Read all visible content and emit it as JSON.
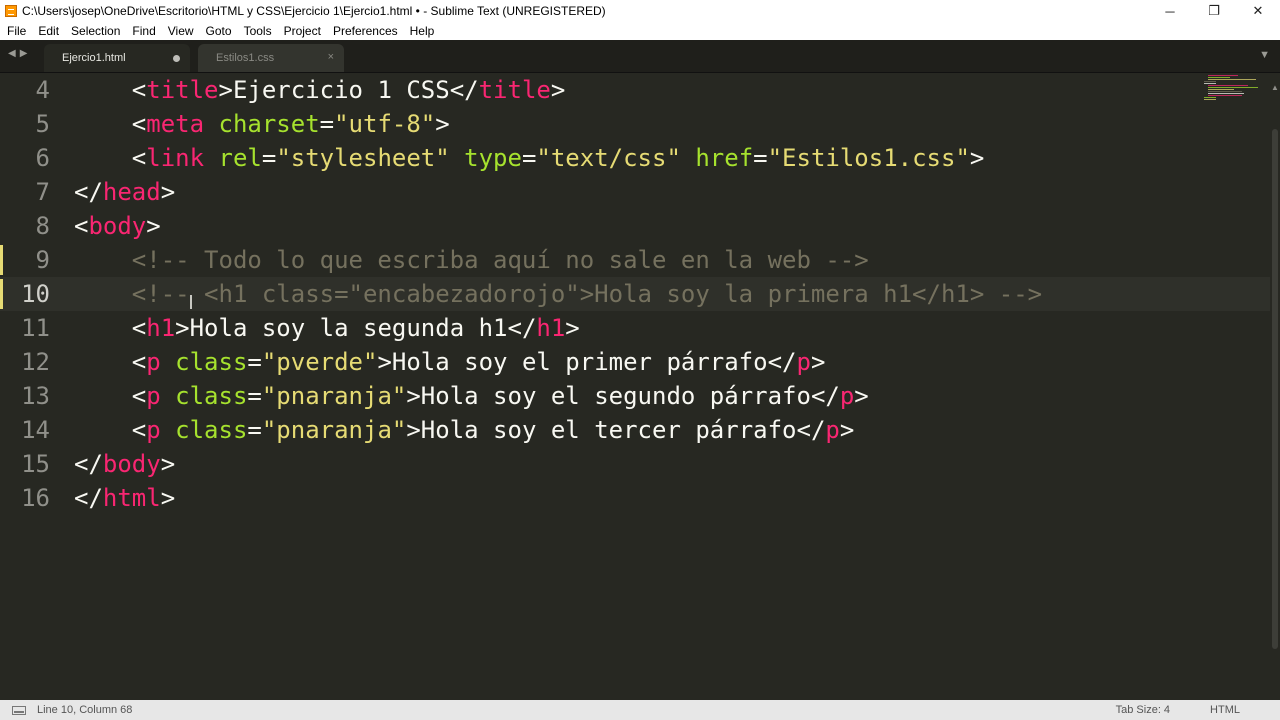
{
  "window": {
    "title": "C:\\Users\\josep\\OneDrive\\Escritorio\\HTML y CSS\\Ejercicio 1\\Ejercio1.html • - Sublime Text (UNREGISTERED)",
    "minimize_glyph": "─",
    "restore_glyph": "❐",
    "close_glyph": "✕"
  },
  "menu": [
    "File",
    "Edit",
    "Selection",
    "Find",
    "View",
    "Goto",
    "Tools",
    "Project",
    "Preferences",
    "Help"
  ],
  "tabs": {
    "active_label": "Ejercio1.html",
    "inactive_label": "Estilos1.css",
    "close_glyph": "×",
    "dropdown_glyph": "▼",
    "nav_left_glyph": "◀",
    "nav_right_glyph": "▶"
  },
  "editor": {
    "current_line": 10,
    "line_numbers": [
      "4",
      "5",
      "6",
      "7",
      "8",
      "9",
      "10",
      "11",
      "12",
      "13",
      "14",
      "15",
      "16"
    ],
    "lines": [
      [
        [
          "pl",
          "    <"
        ],
        [
          "tg",
          "title"
        ],
        [
          "pl",
          ">Ejercicio 1 CSS</"
        ],
        [
          "tg",
          "title"
        ],
        [
          "pl",
          ">"
        ]
      ],
      [
        [
          "pl",
          "    <"
        ],
        [
          "tg",
          "meta"
        ],
        [
          "pl",
          " "
        ],
        [
          "at",
          "charset"
        ],
        [
          "pl",
          "="
        ],
        [
          "st",
          "\"utf-8\""
        ],
        [
          "pl",
          ">"
        ]
      ],
      [
        [
          "pl",
          "    <"
        ],
        [
          "tg",
          "link"
        ],
        [
          "pl",
          " "
        ],
        [
          "at",
          "rel"
        ],
        [
          "pl",
          "="
        ],
        [
          "st",
          "\"stylesheet\""
        ],
        [
          "pl",
          " "
        ],
        [
          "at",
          "type"
        ],
        [
          "pl",
          "="
        ],
        [
          "st",
          "\"text/css\""
        ],
        [
          "pl",
          " "
        ],
        [
          "at",
          "href"
        ],
        [
          "pl",
          "="
        ],
        [
          "st",
          "\"Estilos1.css\""
        ],
        [
          "pl",
          ">"
        ]
      ],
      [
        [
          "pl",
          "</"
        ],
        [
          "tg",
          "head"
        ],
        [
          "pl",
          ">"
        ]
      ],
      [
        [
          "pl",
          "<"
        ],
        [
          "tg",
          "body"
        ],
        [
          "pl",
          ">"
        ]
      ],
      [
        [
          "cm",
          "    <!-- Todo lo que escriba aquí no sale en la web -->"
        ]
      ],
      [
        [
          "cm",
          "    <!-- <h1 class=\"encabezadorojo\">Hola soy la primera h1</h1> -->"
        ]
      ],
      [
        [
          "pl",
          "    <"
        ],
        [
          "tg",
          "h1"
        ],
        [
          "pl",
          ">Hola soy la segunda h1</"
        ],
        [
          "tg",
          "h1"
        ],
        [
          "pl",
          ">"
        ]
      ],
      [
        [
          "pl",
          "    <"
        ],
        [
          "tg",
          "p"
        ],
        [
          "pl",
          " "
        ],
        [
          "at",
          "class"
        ],
        [
          "pl",
          "="
        ],
        [
          "st",
          "\"pverde\""
        ],
        [
          "pl",
          ">Hola soy el primer párrafo</"
        ],
        [
          "tg",
          "p"
        ],
        [
          "pl",
          ">"
        ]
      ],
      [
        [
          "pl",
          "    <"
        ],
        [
          "tg",
          "p"
        ],
        [
          "pl",
          " "
        ],
        [
          "at",
          "class"
        ],
        [
          "pl",
          "="
        ],
        [
          "st",
          "\"pnaranja\""
        ],
        [
          "pl",
          ">Hola soy el segundo párrafo</"
        ],
        [
          "tg",
          "p"
        ],
        [
          "pl",
          ">"
        ]
      ],
      [
        [
          "pl",
          "    <"
        ],
        [
          "tg",
          "p"
        ],
        [
          "pl",
          " "
        ],
        [
          "at",
          "class"
        ],
        [
          "pl",
          "="
        ],
        [
          "st",
          "\"pnaranja\""
        ],
        [
          "pl",
          ">Hola soy el tercer párrafo</"
        ],
        [
          "tg",
          "p"
        ],
        [
          "pl",
          ">"
        ]
      ],
      [
        [
          "pl",
          "</"
        ],
        [
          "tg",
          "body"
        ],
        [
          "pl",
          ">"
        ]
      ],
      [
        [
          "pl",
          "</"
        ],
        [
          "tg",
          "html"
        ],
        [
          "pl",
          ">"
        ]
      ]
    ],
    "colors": {
      "background": "#272822",
      "tag": "#f92672",
      "attribute": "#a6e22e",
      "string": "#e6db74",
      "comment": "#75715e",
      "text": "#f8f8f2"
    }
  },
  "status": {
    "position": "Line 10, Column 68",
    "tab_size": "Tab Size: 4",
    "syntax": "HTML"
  }
}
